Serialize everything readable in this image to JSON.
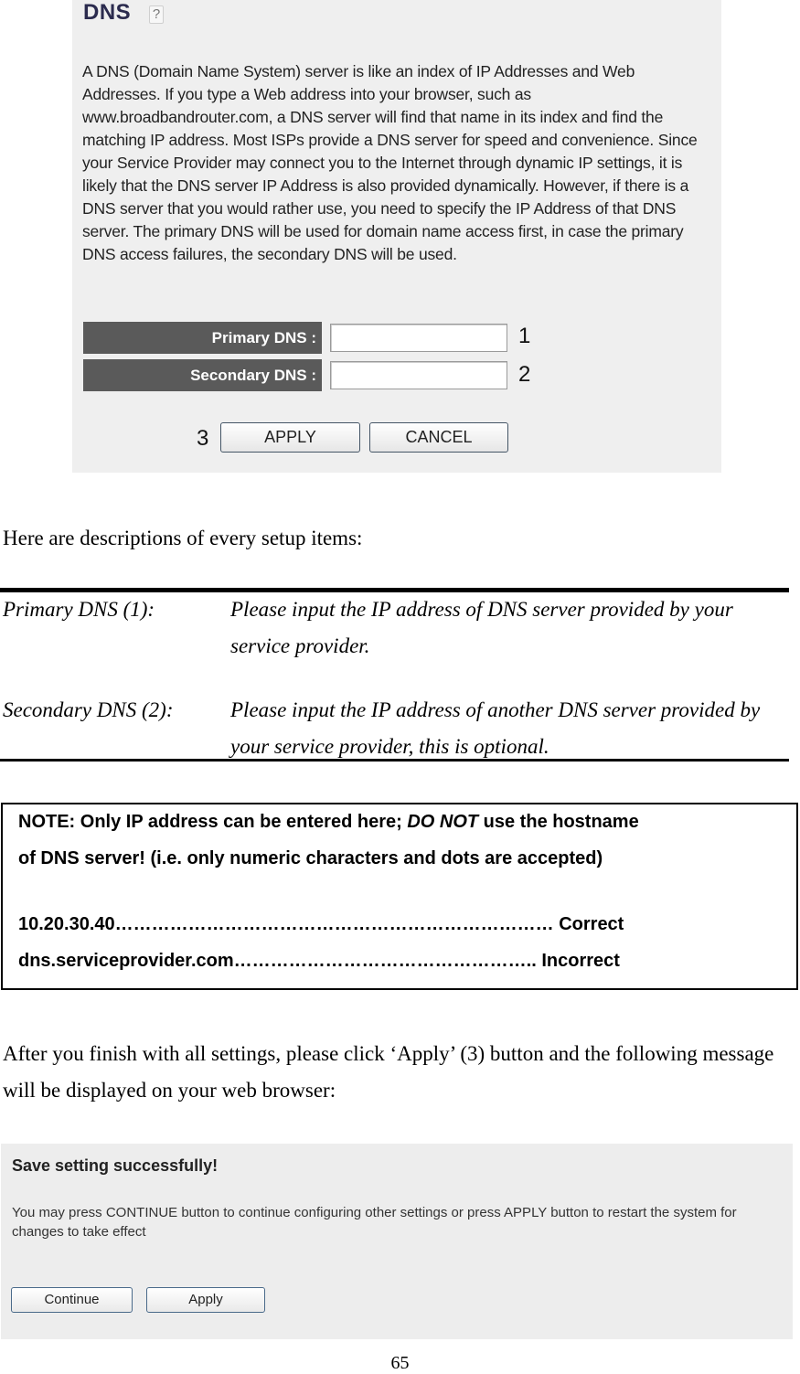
{
  "dns_panel": {
    "title": "DNS",
    "help_icon": "?",
    "description": "A DNS (Domain Name System) server is like an index of IP Addresses and Web Addresses. If you type a Web address into your browser, such as www.broadbandrouter.com, a DNS server will find that name in its index and find the matching IP address. Most ISPs provide a DNS server for speed and convenience. Since your Service Provider may connect you to the Internet through dynamic IP settings, it is likely that the DNS server IP Address is also provided dynamically. However, if there is a DNS server that you would rather use, you need to specify the IP Address of that DNS server. The primary DNS will be used for domain name access first, in case the primary DNS access failures, the secondary DNS will be used.",
    "fields": [
      {
        "label": "Primary DNS :",
        "value": "",
        "marker": "1"
      },
      {
        "label": "Secondary DNS :",
        "value": "",
        "marker": "2"
      }
    ],
    "buttons": {
      "apply": "APPLY",
      "cancel": "CANCEL",
      "apply_marker": "3"
    }
  },
  "intro_text": "Here are descriptions of every setup items:",
  "descriptions": [
    {
      "term": "Primary DNS (1):",
      "definition": "Please input the IP address of DNS server provided by your service provider."
    },
    {
      "term": "Secondary DNS (2):",
      "definition": "Please input the IP address of another DNS server provided by your service provider, this is optional."
    }
  ],
  "note": {
    "line1_prefix": "NOTE: Only IP address can be entered here; ",
    "line1_emphasis": "DO NOT",
    "line1_suffix": " use the hostname",
    "line2": "of DNS server! (i.e. only numeric characters and dots are accepted)",
    "example_correct": "10.20.30.40……………………………………………………………… Correct",
    "example_incorrect": "dns.serviceprovider.com………………………………………….. Incorrect"
  },
  "after_text": "After you finish with all settings, please click ‘Apply’ (3) button and the following message will be displayed on your web browser:",
  "success_panel": {
    "title": "Save setting successfully!",
    "message": "You may press CONTINUE button to continue configuring other settings or press APPLY button to restart the system for changes to take effect",
    "buttons": {
      "continue": "Continue",
      "apply": "Apply"
    }
  },
  "page_number": "65"
}
